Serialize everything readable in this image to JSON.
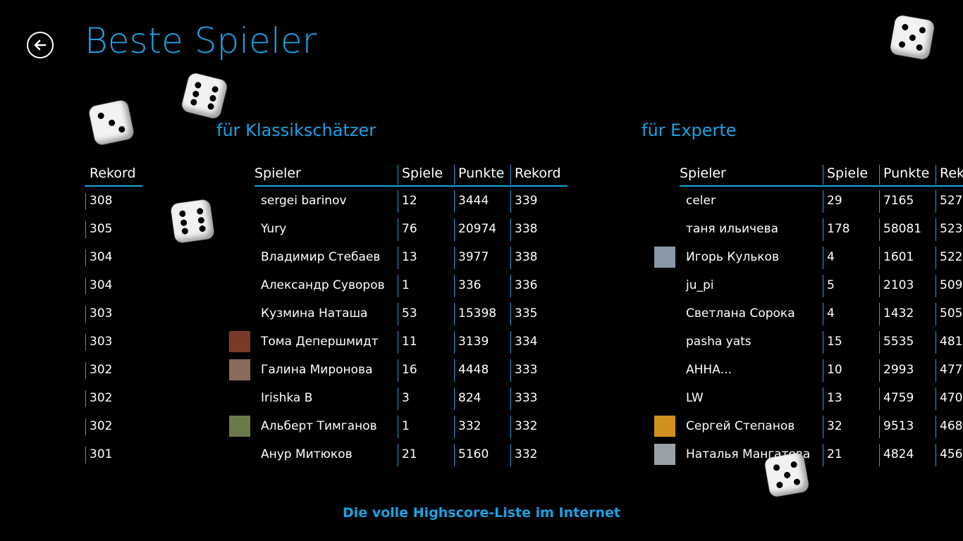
{
  "header": {
    "title": "Beste Spieler",
    "back_icon": "back-arrow-icon"
  },
  "left_partial": {
    "columns": {
      "record": "Rekord"
    },
    "records": [
      "308",
      "305",
      "304",
      "304",
      "303",
      "303",
      "302",
      "302",
      "302",
      "301"
    ]
  },
  "classic": {
    "title": "für Klassikschätzer",
    "columns": {
      "player": "Spieler",
      "games": "Spiele",
      "points": "Punkte",
      "record": "Rekord"
    },
    "rows": [
      {
        "player": "sergei barinov",
        "games": "12",
        "points": "3444",
        "record": "339",
        "avatar": ""
      },
      {
        "player": "Yury",
        "games": "76",
        "points": "20974",
        "record": "338",
        "avatar": ""
      },
      {
        "player": "Владимир Стебаев",
        "games": "13",
        "points": "3977",
        "record": "338",
        "avatar": ""
      },
      {
        "player": "Александр Суворов",
        "games": "1",
        "points": "336",
        "record": "336",
        "avatar": ""
      },
      {
        "player": "Кузмина Наташа",
        "games": "53",
        "points": "15398",
        "record": "335",
        "avatar": ""
      },
      {
        "player": "Тома Депершмидт",
        "games": "11",
        "points": "3139",
        "record": "334",
        "avatar": "#7a3a2a"
      },
      {
        "player": "Галина Миронова",
        "games": "16",
        "points": "4448",
        "record": "333",
        "avatar": "#8a6a5a"
      },
      {
        "player": "Irishka B",
        "games": "3",
        "points": "824",
        "record": "333",
        "avatar": ""
      },
      {
        "player": "Альберт Тимганов",
        "games": "1",
        "points": "332",
        "record": "332",
        "avatar": "#6b7a4a"
      },
      {
        "player": "Анур Митюков",
        "games": "21",
        "points": "5160",
        "record": "332",
        "avatar": ""
      }
    ]
  },
  "expert": {
    "title": "für Experte",
    "columns": {
      "player": "Spieler",
      "games": "Spiele",
      "points": "Punkte",
      "record": "Reko"
    },
    "rows": [
      {
        "player": "celer",
        "games": "29",
        "points": "7165",
        "record": "527",
        "avatar": ""
      },
      {
        "player": "таня ильичева",
        "games": "178",
        "points": "58081",
        "record": "523",
        "avatar": ""
      },
      {
        "player": "Игорь Кульков",
        "games": "4",
        "points": "1601",
        "record": "522",
        "avatar": "#8a97a8"
      },
      {
        "player": "ju_pi",
        "games": "5",
        "points": "2103",
        "record": "509",
        "avatar": ""
      },
      {
        "player": "Светлана Сорока",
        "games": "4",
        "points": "1432",
        "record": "505",
        "avatar": ""
      },
      {
        "player": "pasha yats",
        "games": "15",
        "points": "5535",
        "record": "481",
        "avatar": ""
      },
      {
        "player": "АННА...",
        "games": "10",
        "points": "2993",
        "record": "477",
        "avatar": ""
      },
      {
        "player": "LW",
        "games": "13",
        "points": "4759",
        "record": "470",
        "avatar": ""
      },
      {
        "player": "Сергей Степанов",
        "games": "32",
        "points": "9513",
        "record": "468",
        "avatar": "#d09020"
      },
      {
        "player": "Наталья Мангатова",
        "games": "21",
        "points": "4824",
        "record": "456",
        "avatar": "#9aa2a8"
      }
    ]
  },
  "footer": {
    "link": "Die volle Highscore-Liste im Internet"
  },
  "decorations": {
    "dice_icon": "dice-icon"
  }
}
